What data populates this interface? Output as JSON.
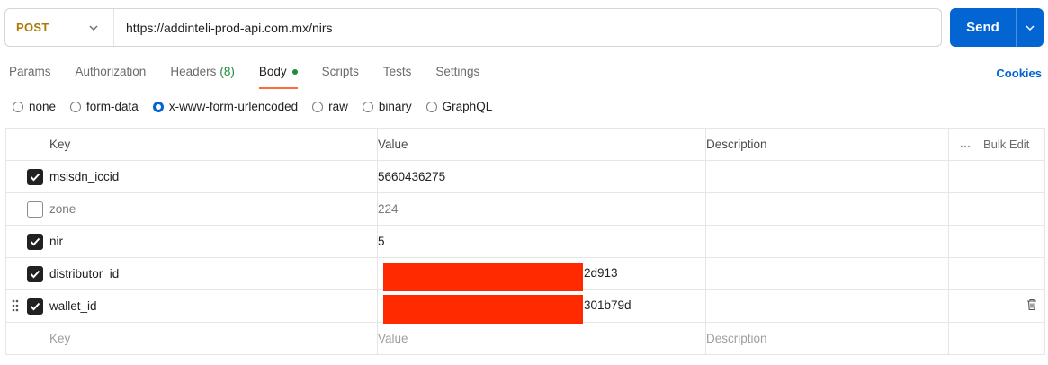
{
  "request": {
    "method": "POST",
    "url": "https://addinteli-prod-api.com.mx/nirs",
    "send_label": "Send"
  },
  "tabs": [
    {
      "label": "Params"
    },
    {
      "label": "Authorization"
    },
    {
      "label": "Headers",
      "count": "(8)"
    },
    {
      "label": "Body",
      "active": true
    },
    {
      "label": "Scripts"
    },
    {
      "label": "Tests"
    },
    {
      "label": "Settings"
    }
  ],
  "cookies_label": "Cookies",
  "body_types": [
    {
      "label": "none",
      "selected": false
    },
    {
      "label": "form-data",
      "selected": false
    },
    {
      "label": "x-www-form-urlencoded",
      "selected": true
    },
    {
      "label": "raw",
      "selected": false
    },
    {
      "label": "binary",
      "selected": false
    },
    {
      "label": "GraphQL",
      "selected": false
    }
  ],
  "table": {
    "headers": {
      "key": "Key",
      "value": "Value",
      "description": "Description",
      "bulk_edit": "Bulk Edit"
    },
    "rows": [
      {
        "checked": true,
        "key": "msisdn_iccid",
        "value": "5660436275"
      },
      {
        "checked": false,
        "key": "zone",
        "value": "224"
      },
      {
        "checked": true,
        "key": "nir",
        "value": "5"
      },
      {
        "checked": true,
        "key": "distributor_id",
        "value_visible": "2d913",
        "redacted": true
      },
      {
        "checked": true,
        "key": "wallet_id",
        "value_visible": "301b79d",
        "redacted": true
      }
    ],
    "placeholders": {
      "key": "Key",
      "value": "Value",
      "description": "Description"
    }
  },
  "colors": {
    "accent": "#0265d2",
    "method": "#ad7a03",
    "active_tab": "#ff6c37",
    "redaction": "#ff2a00"
  }
}
